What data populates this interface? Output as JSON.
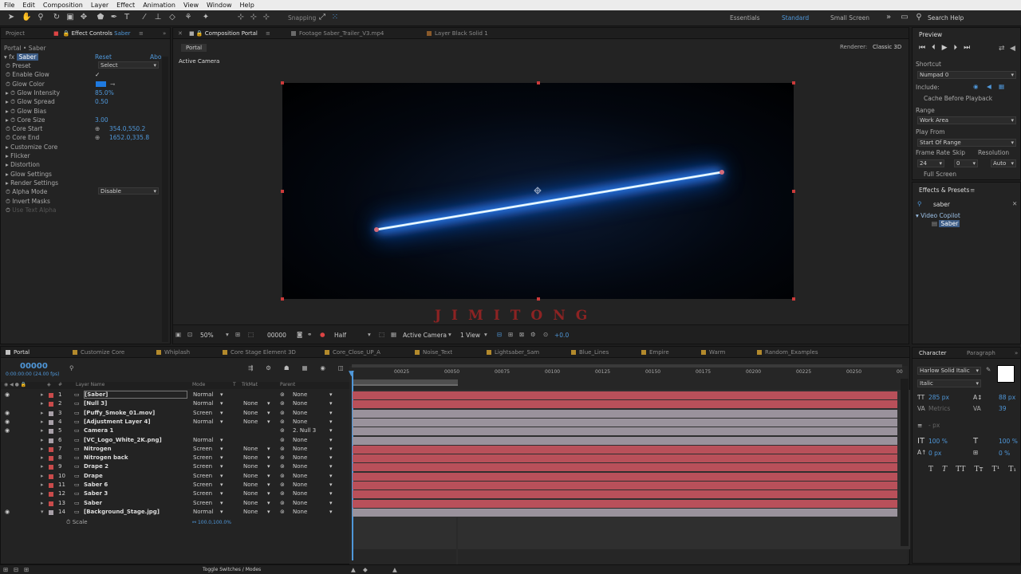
{
  "menu": [
    "File",
    "Edit",
    "Composition",
    "Layer",
    "Effect",
    "Animation",
    "View",
    "Window",
    "Help"
  ],
  "toolbar": {
    "snapping": "Snapping",
    "workspaces": [
      "Essentials",
      "Standard",
      "Small Screen"
    ],
    "active_workspace": "Standard",
    "search_placeholder": "Search Help"
  },
  "left_panel": {
    "tabs": [
      "Project",
      "Effect Controls Saber"
    ],
    "tab_effect_prefix": "Effect Controls",
    "tab_effect_layer": "Saber",
    "breadcrumb": "Portal • Saber",
    "effect_name": "Saber",
    "reset": "Reset",
    "about": "Abo",
    "props": [
      {
        "label": "Preset",
        "value": "Select",
        "kind": "dropdown"
      },
      {
        "label": "Enable Glow",
        "value": "✓",
        "kind": "check"
      },
      {
        "label": "Glow Color",
        "value": "",
        "kind": "color"
      },
      {
        "label": "Glow Intensity",
        "value": "85.0%",
        "kind": "num"
      },
      {
        "label": "Glow Spread",
        "value": "0.50",
        "kind": "num"
      },
      {
        "label": "Glow Bias",
        "value": "",
        "kind": "num"
      },
      {
        "label": "Core Size",
        "value": "3.00",
        "kind": "num"
      },
      {
        "label": "Core Start",
        "value": "354.0,550.2",
        "kind": "point"
      },
      {
        "label": "Core End",
        "value": "1652.0,335.8",
        "kind": "point"
      },
      {
        "label": "Customize Core",
        "value": "",
        "kind": "group"
      },
      {
        "label": "Flicker",
        "value": "",
        "kind": "group"
      },
      {
        "label": "Distortion",
        "value": "",
        "kind": "group"
      },
      {
        "label": "Glow Settings",
        "value": "",
        "kind": "group"
      },
      {
        "label": "Render Settings",
        "value": "",
        "kind": "group"
      },
      {
        "label": "Alpha Mode",
        "value": "Disable",
        "kind": "dropdown"
      },
      {
        "label": "Invert Masks",
        "value": "",
        "kind": "check"
      },
      {
        "label": "Use Text Alpha",
        "value": "",
        "kind": "disabled"
      }
    ]
  },
  "comp_panel": {
    "tabs": [
      "Composition Portal",
      "Footage Saber_Trailer_V3.mp4",
      "Layer Black Solid 1"
    ],
    "subtab": "Portal",
    "renderer_label": "Renderer:",
    "renderer_value": "Classic 3D",
    "camera_label": "Active Camera",
    "watermark": "JIMITONG",
    "footer": {
      "zoom": "50%",
      "timecode": "00000",
      "resolution": "Half",
      "camera": "Active Camera",
      "views": "1 View",
      "exposure": "+0.0"
    }
  },
  "right_panel": {
    "preview": {
      "title": "Preview",
      "shortcut_label": "Shortcut",
      "shortcut_value": "Numpad 0",
      "include_label": "Include:",
      "cache_label": "Cache Before Playback",
      "range_label": "Range",
      "range_value": "Work Area",
      "play_from_label": "Play From",
      "play_from_value": "Start Of Range",
      "frame_rate_label": "Frame Rate",
      "skip_label": "Skip",
      "resolution_label": "Resolution",
      "frame_rate_value": "24",
      "skip_value": "0",
      "resolution_value": "Auto",
      "full_screen_label": "Full Screen"
    },
    "effects": {
      "title": "Effects & Presets",
      "search_value": "saber",
      "folder": "Video Copilot",
      "item": "Saber"
    },
    "character": {
      "tabs": [
        "Character",
        "Paragraph"
      ],
      "font": "Harlow Solid Italic",
      "style": "Italic",
      "size": "285 px",
      "leading": "88 px",
      "kerning": "Metrics",
      "tracking": "39",
      "stroke": "- px",
      "vscale": "100 %",
      "hscale": "100 %",
      "baseline": "0 px",
      "tsume": "0 %",
      "text_styles": [
        "T",
        "T",
        "TT",
        "Tт",
        "T¹",
        "T₁"
      ]
    }
  },
  "timeline": {
    "tabs": [
      "Portal",
      "Customize Core",
      "Whiplash",
      "Core Stage Element 3D",
      "Core_Close_UP_A",
      "Noise_Text",
      "Lightsaber_Sam",
      "Blue_Lines",
      "Empire",
      "Warm",
      "Random_Examples"
    ],
    "timecode": "00000",
    "fps_label": "0:00:00:00 (24.00 fps)",
    "headers": {
      "layer_name": "Layer Name",
      "mode": "Mode",
      "t": "T",
      "trkmat": "TrkMat",
      "parent": "Parent"
    },
    "ruler": [
      "00025",
      "00050",
      "00075",
      "00100",
      "00125",
      "00150",
      "00175",
      "00200",
      "00225",
      "00250",
      "00"
    ],
    "layers": [
      {
        "num": "1",
        "name": "[Saber]",
        "mode": "Normal",
        "trkmat": "",
        "parent": "None",
        "color": "#c94b4b",
        "bar": "#b9505a"
      },
      {
        "num": "2",
        "name": "[Null 3]",
        "mode": "Normal",
        "trkmat": "None",
        "parent": "None",
        "color": "#c94b4b",
        "bar": "#b9505a"
      },
      {
        "num": "3",
        "name": "[Puffy_Smoke_01.mov]",
        "mode": "Screen",
        "trkmat": "None",
        "parent": "None",
        "color": "#a8a0a8",
        "bar": "#9a929c"
      },
      {
        "num": "4",
        "name": "[Adjustment Layer 4]",
        "mode": "Normal",
        "trkmat": "None",
        "parent": "None",
        "color": "#a8a0a8",
        "bar": "#9a929c"
      },
      {
        "num": "5",
        "name": "Camera 1",
        "mode": "",
        "trkmat": "",
        "parent": "2. Null 3",
        "color": "#a8a0a8",
        "bar": "#9a929c"
      },
      {
        "num": "6",
        "name": "[VC_Logo_White_2K.png]",
        "mode": "Normal",
        "trkmat": "",
        "parent": "None",
        "color": "#a8a0a8",
        "bar": "#9a929c"
      },
      {
        "num": "7",
        "name": "Nitrogen",
        "mode": "Screen",
        "trkmat": "None",
        "parent": "None",
        "color": "#c94b4b",
        "bar": "#b9505a"
      },
      {
        "num": "8",
        "name": "Nitrogen back",
        "mode": "Screen",
        "trkmat": "None",
        "parent": "None",
        "color": "#c94b4b",
        "bar": "#b9505a"
      },
      {
        "num": "9",
        "name": "Drape 2",
        "mode": "Screen",
        "trkmat": "None",
        "parent": "None",
        "color": "#c94b4b",
        "bar": "#b9505a"
      },
      {
        "num": "10",
        "name": "Drape",
        "mode": "Screen",
        "trkmat": "None",
        "parent": "None",
        "color": "#c94b4b",
        "bar": "#b9505a"
      },
      {
        "num": "11",
        "name": "Saber 6",
        "mode": "Screen",
        "trkmat": "None",
        "parent": "None",
        "color": "#c94b4b",
        "bar": "#b9505a"
      },
      {
        "num": "12",
        "name": "Saber 3",
        "mode": "Screen",
        "trkmat": "None",
        "parent": "None",
        "color": "#c94b4b",
        "bar": "#b9505a"
      },
      {
        "num": "13",
        "name": "Saber",
        "mode": "Screen",
        "trkmat": "None",
        "parent": "None",
        "color": "#c94b4b",
        "bar": "#b9505a"
      },
      {
        "num": "14",
        "name": "[Background_Stage.jpg]",
        "mode": "Normal",
        "trkmat": "None",
        "parent": "None",
        "color": "#a8a0a8",
        "bar": "#9a929c"
      }
    ],
    "scale_label": "Scale",
    "scale_value": "100.0,100.0%",
    "footer_toggle": "Toggle Switches / Modes"
  }
}
